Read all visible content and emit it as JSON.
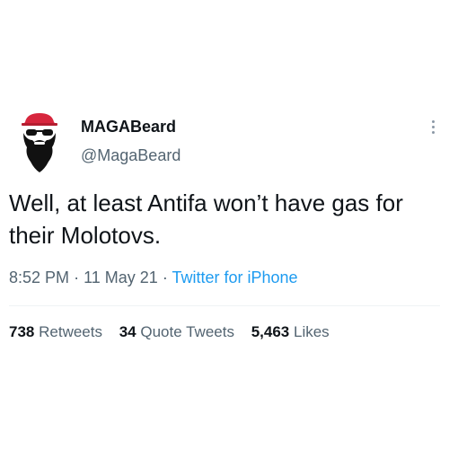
{
  "author": {
    "display_name": "MAGABeard",
    "handle": "@MagaBeard",
    "avatar_icon": "bearded-man-red-cap-avatar-icon"
  },
  "tweet": {
    "text": "Well, at least Antifa won’t have gas for their Molotovs.",
    "time": "8:52 PM",
    "date": "11 May 21",
    "source": "Twitter for iPhone",
    "separator": "·"
  },
  "stats": {
    "retweets": {
      "count": "738",
      "label": "Retweets"
    },
    "quote_tweets": {
      "count": "34",
      "label": "Quote Tweets"
    },
    "likes": {
      "count": "5,463",
      "label": "Likes"
    }
  },
  "menu_icon": "more-vertical-icon",
  "colors": {
    "text_primary": "#0f1419",
    "text_secondary": "#536471",
    "link": "#1d9bf0",
    "cap_red": "#d7263d"
  }
}
